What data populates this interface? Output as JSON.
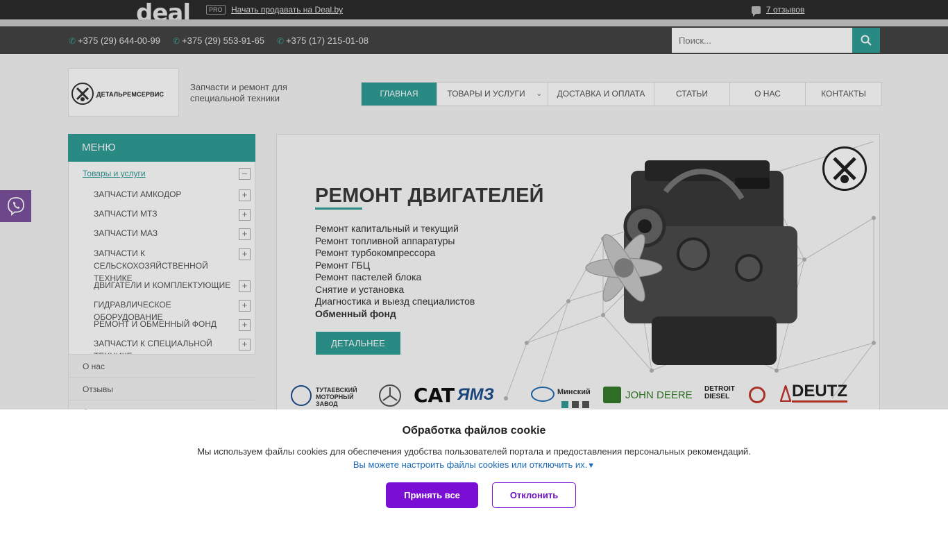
{
  "topbar": {
    "logo": "deal",
    "pro_badge": "PRO",
    "sell_link": "Начать продавать на Deal.by",
    "reviews": "7 отзывов"
  },
  "phones": [
    "+375 (29) 644-00-99",
    "+375 (29) 553-91-65",
    "+375 (17) 215-01-08"
  ],
  "search": {
    "placeholder": "Поиск..."
  },
  "brand": {
    "name": "ДЕТАЛЬРЕМСЕРВИС",
    "tagline": "Запчасти и ремонт для специальной техники"
  },
  "nav": {
    "items": [
      {
        "label": "ГЛАВНАЯ"
      },
      {
        "label": "ТОВАРЫ И УСЛУГИ"
      },
      {
        "label": "ДОСТАВКА И ОПЛАТА"
      },
      {
        "label": "СТАТЬИ"
      },
      {
        "label": "О НАС"
      },
      {
        "label": "КОНТАКТЫ"
      }
    ]
  },
  "sidebar": {
    "title": "МЕНЮ",
    "top_item": "Товары и услуги",
    "sub_items": [
      "ЗАПЧАСТИ АМКОДОР",
      "ЗАПЧАСТИ МТЗ",
      "ЗАПЧАСТИ МАЗ",
      "ЗАПЧАСТИ К СЕЛЬСКОХОЗЯЙСТВЕННОЙ ТЕХНИКЕ",
      "ДВИГАТЕЛИ И КОМПЛЕКТУЮЩИЕ",
      "ГИДРАВЛИЧЕСКОЕ ОБОРУДОВАНИЕ",
      "РЕМОНТ И ОБМЕННЫЙ ФОНД",
      "ЗАПЧАСТИ К СПЕЦИАЛЬНОЙ ТЕХНИКЕ"
    ],
    "sections": [
      "О нас",
      "Отзывы",
      "Статьи"
    ]
  },
  "banner": {
    "title": "РЕМОНТ ДВИГАТЕЛЕЙ",
    "services": [
      "Ремонт капитальный и текущий",
      "Ремонт топливной аппаратуры",
      "Ремонт турбокомпрессора",
      "Ремонт ГБЦ",
      "Ремонт пастелей блока",
      "Снятие и установка",
      "Диагностика и выезд специалистов"
    ],
    "service_bold": "Обменный фонд",
    "button": "ДЕТАЛЬНЕЕ",
    "brand_logos": {
      "tmz": "ТУТАЕВСКИЙ МОТОРНЫЙ ЗАВОД",
      "cat": "CAT",
      "yamz": "ЯМЗ",
      "minsk": "Минский",
      "jd": "JOHN DEERE",
      "detroit": "DETROIT DIESEL",
      "deutz": "DEUTZ"
    }
  },
  "cookie": {
    "title": "Обработка файлов cookie",
    "text": "Мы используем файлы cookies для обеспечения удобства пользователей портала и предоставления персональных рекомендаций.",
    "link": "Вы можете настроить файлы cookies или отключить их.",
    "accept": "Принять все",
    "decline": "Отклонить"
  },
  "colors": {
    "accent": "#2f9c96",
    "accept_button": "#7b0ed4",
    "viber": "#7b519d"
  }
}
